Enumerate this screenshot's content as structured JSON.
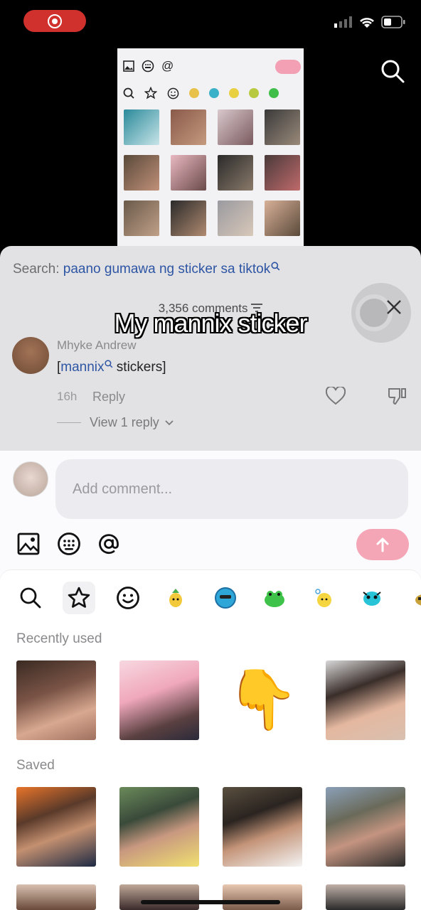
{
  "status_bar": {
    "record_icon": "screen-record-icon",
    "signal_icon": "signal-bars-icon",
    "wifi_icon": "wifi-icon",
    "battery_icon": "battery-icon"
  },
  "top_search_icon": "search-icon",
  "comments": {
    "search_prefix": "Search: ",
    "search_query": "paano gumawa ng sticker sa tiktok",
    "count_label": "3,356 comments",
    "close_icon": "close-icon",
    "items": [
      {
        "author": "Mhyke Andrew",
        "text_open": "[",
        "text_tag": "mannix",
        "text_rest": " stickers]",
        "time": "16h",
        "reply_label": "Reply",
        "view_replies_label": "View 1 reply"
      }
    ]
  },
  "overlay_caption": "My mannix sticker",
  "composer": {
    "placeholder": "Add comment...",
    "image_icon": "image-icon",
    "emoji_keyboard_icon": "emoji-keyboard-icon",
    "mention_icon": "at-mention-icon",
    "send_icon": "send-arrow-icon"
  },
  "sticker_panel": {
    "tabs": [
      "search-icon",
      "star-icon",
      "smiley-icon",
      "sticker-pineapple-icon",
      "sticker-blue-creature-icon",
      "sticker-green-frog-icon",
      "sticker-yellow-duck-icon",
      "sticker-teal-creature-icon",
      "sticker-partial-icon"
    ],
    "recently_used_label": "Recently used",
    "saved_label": "Saved",
    "pointing_emoji": "👇"
  },
  "colors": {
    "accent_pink": "#f5a6b6",
    "link_blue": "#2d55a4",
    "record_red": "#d0312d"
  }
}
